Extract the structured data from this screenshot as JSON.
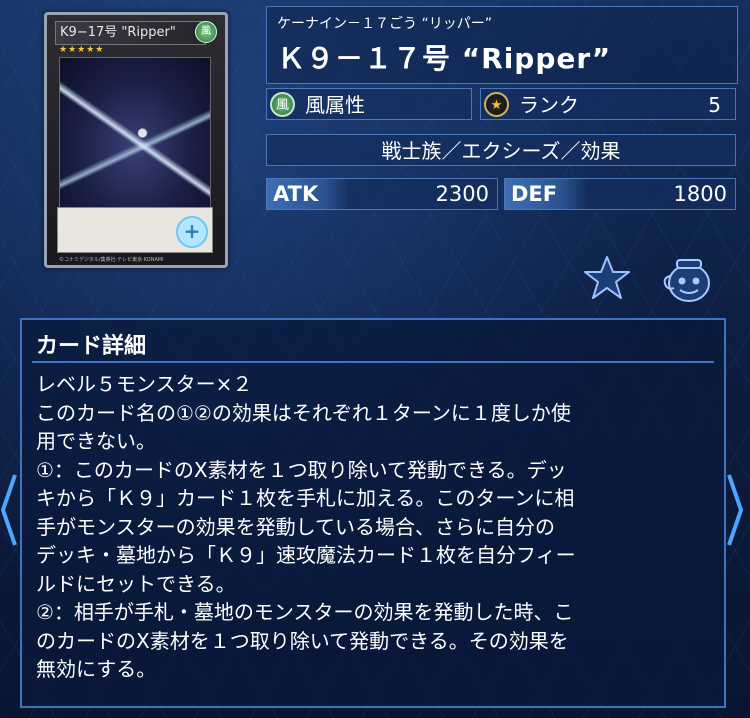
{
  "card_image": {
    "name": "K9−17号 \"Ripper\"",
    "attribute_symbol": "風",
    "stars": "★★★★★",
    "zoom_icon": "zoom-in-icon",
    "copyright": "©コナミデジタル/集英社·テレビ東京·KONAMI"
  },
  "header": {
    "ruby": "ケーナイン－１７ごう “リッパー”",
    "title": "Ｋ９－１７号 “Ripper”"
  },
  "attribute": {
    "icon_char": "風",
    "label": "風属性",
    "color": "#4a9b59"
  },
  "rank": {
    "icon_char": "★",
    "label": "ランク",
    "value": "5",
    "color": "#f2c13b"
  },
  "type_line": "戦士族／エクシーズ／効果",
  "stats": {
    "atk_label": "ATK",
    "atk_value": "2300",
    "def_label": "DEF",
    "def_value": "1800"
  },
  "actions": {
    "favorite_icon": "star-outline-icon",
    "deck_icon": "deck-pot-icon"
  },
  "detail": {
    "heading": "カード詳細",
    "lines": [
      "レベル５モンスター×２",
      "このカード名の①②の効果はそれぞれ１ターンに１度しか使",
      "用できない。",
      "①：このカードのX素材を１つ取り除いて発動できる。デッ",
      "キから「Ｋ９」カード１枚を手札に加える。このターンに相",
      "手がモンスターの効果を発動している場合、さらに自分の",
      "デッキ・墓地から「Ｋ９」速攻魔法カード１枚を自分フィー",
      "ルドにセットできる。",
      "②：相手が手札・墓地のモンスターの効果を発動した時、こ",
      "のカードのX素材を１つ取り除いて発動できる。その効果を",
      "無効にする。"
    ]
  },
  "nav": {
    "prev": "〈",
    "next": "〉"
  },
  "colors": {
    "panel_border": "#3f73bf",
    "background": "#0b1a36",
    "nav_arrow": "#4fa6ff"
  }
}
